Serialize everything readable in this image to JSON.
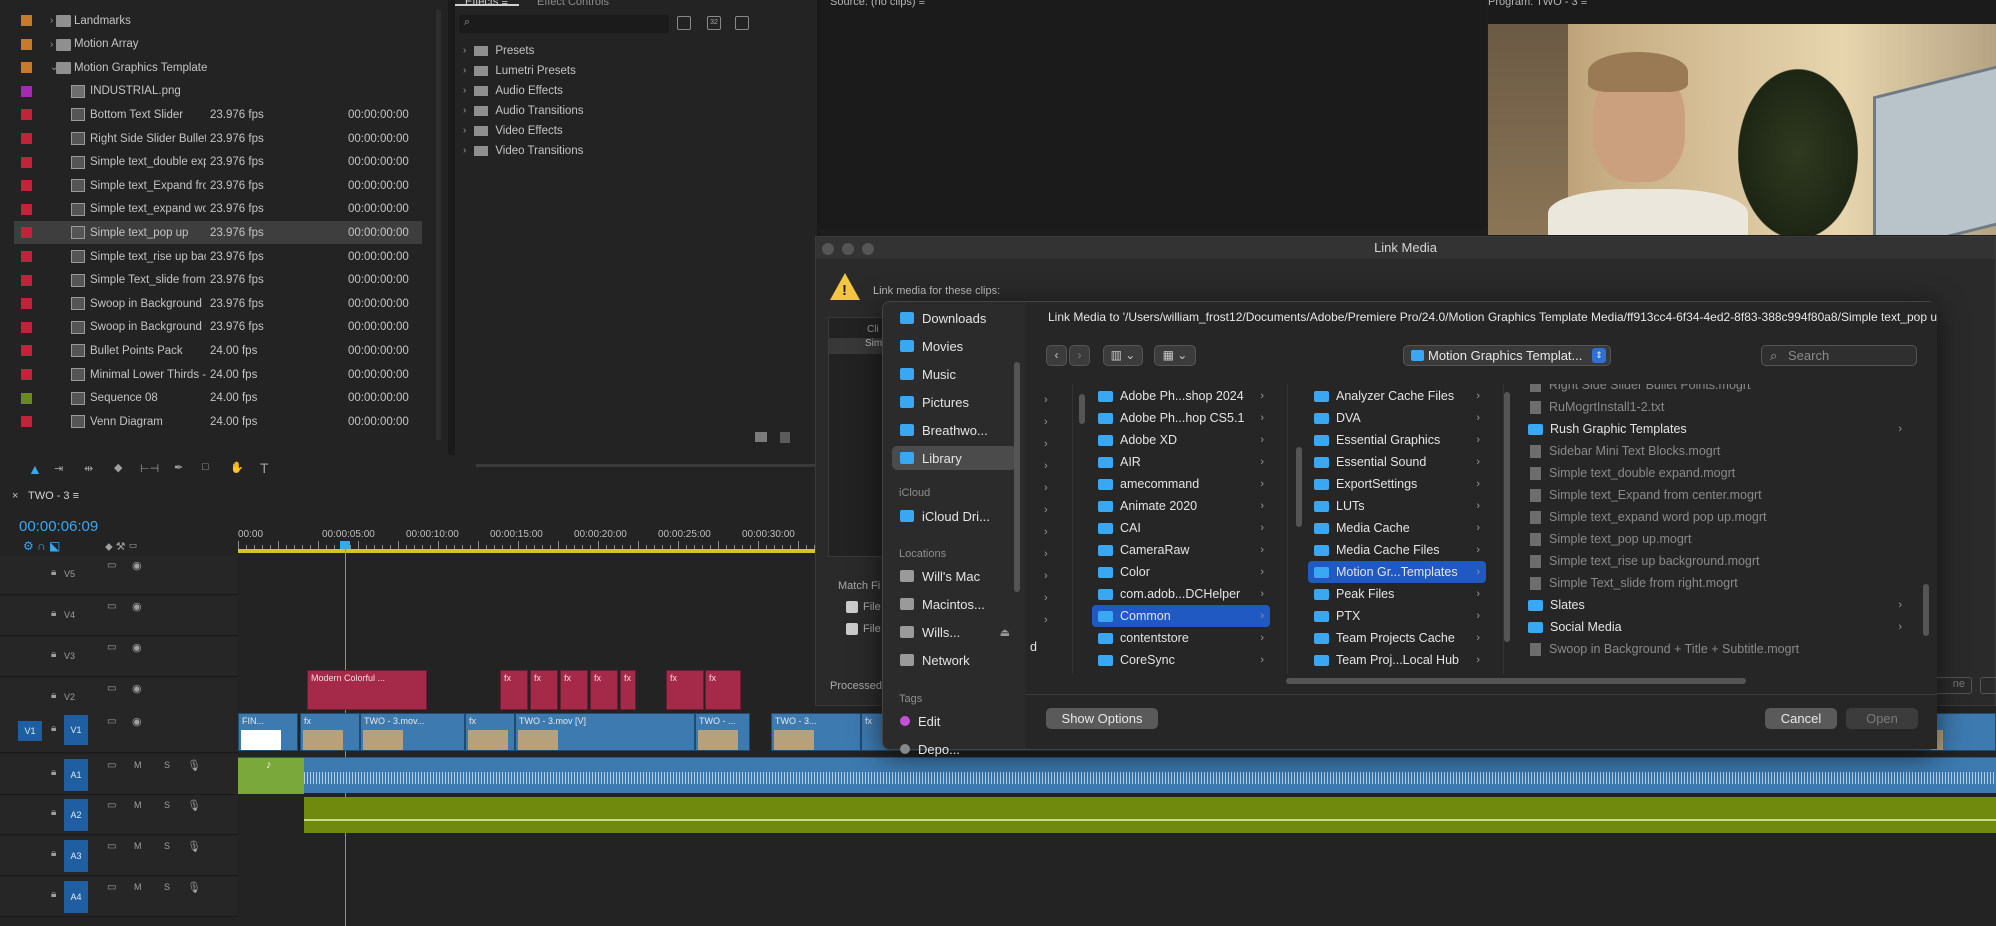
{
  "project": {
    "rows": [
      {
        "name": "Landmarks",
        "type": "folder",
        "color": "#c77a2a",
        "fps": "",
        "dur": ""
      },
      {
        "name": "Motion Array",
        "type": "folder",
        "color": "#c77a2a",
        "fps": "",
        "dur": ""
      },
      {
        "name": "Motion Graphics Template",
        "type": "folder-open",
        "color": "#c77a2a",
        "fps": "",
        "dur": ""
      },
      {
        "name": "INDUSTRIAL.png",
        "type": "image",
        "color": "#a42ab0",
        "fps": "",
        "dur": ""
      },
      {
        "name": "Bottom Text Slider",
        "type": "clip",
        "color": "#c2233a",
        "fps": "23.976 fps",
        "dur": "00:00:00:00"
      },
      {
        "name": "Right Side Slider Bullet",
        "type": "clip",
        "color": "#c2233a",
        "fps": "23.976 fps",
        "dur": "00:00:00:00"
      },
      {
        "name": "Simple text_double exp",
        "type": "clip",
        "color": "#c2233a",
        "fps": "23.976 fps",
        "dur": "00:00:00:00"
      },
      {
        "name": "Simple text_Expand fro",
        "type": "clip",
        "color": "#c2233a",
        "fps": "23.976 fps",
        "dur": "00:00:00:00"
      },
      {
        "name": "Simple text_expand wor",
        "type": "clip",
        "color": "#c2233a",
        "fps": "23.976 fps",
        "dur": "00:00:00:00"
      },
      {
        "name": "Simple text_pop up",
        "type": "clip",
        "color": "#c2233a",
        "fps": "23.976 fps",
        "dur": "00:00:00:00",
        "selected": true
      },
      {
        "name": "Simple text_rise up bac",
        "type": "clip",
        "color": "#c2233a",
        "fps": "23.976 fps",
        "dur": "00:00:00:00"
      },
      {
        "name": "Simple Text_slide from r",
        "type": "clip",
        "color": "#c2233a",
        "fps": "23.976 fps",
        "dur": "00:00:00:00"
      },
      {
        "name": "Swoop in Background",
        "type": "clip",
        "color": "#c2233a",
        "fps": "23.976 fps",
        "dur": "00:00:00:00"
      },
      {
        "name": "Swoop in Background +",
        "type": "clip",
        "color": "#c2233a",
        "fps": "23.976 fps",
        "dur": "00:00:00:00"
      },
      {
        "name": "Bullet Points Pack",
        "type": "clip",
        "color": "#c2233a",
        "fps": "24.00 fps",
        "dur": "00:00:00:00"
      },
      {
        "name": "Minimal Lower Thirds -",
        "type": "clip",
        "color": "#c2233a",
        "fps": "24.00 fps",
        "dur": "00:00:00:00"
      },
      {
        "name": "Sequence 08",
        "type": "sequence",
        "color": "#6b8a1e",
        "fps": "24.00 fps",
        "dur": "00:00:00:00"
      },
      {
        "name": "Venn Diagram",
        "type": "clip",
        "color": "#c2233a",
        "fps": "24.00 fps",
        "dur": "00:00:00:00"
      }
    ]
  },
  "effects": {
    "tab1": "Effects",
    "tab2": "Effect Controls",
    "items": [
      "Presets",
      "Lumetri Presets",
      "Audio Effects",
      "Audio Transitions",
      "Video Effects",
      "Video Transitions"
    ]
  },
  "source": {
    "label": "Source: (no clips)"
  },
  "program": {
    "label": "Program: TWO - 3"
  },
  "timeline": {
    "tab": "TWO - 3",
    "timecode": "00:00:06:09",
    "ruler": [
      "00:00",
      "00:00:05:00",
      "00:00:10:00",
      "00:00:15:00",
      "00:00:20:00",
      "00:00:25:00",
      "00:00:30:00",
      "00:"
    ],
    "video_tracks": [
      "V5",
      "V4",
      "V3",
      "V2",
      "V1"
    ],
    "audio_tracks": [
      "A1",
      "A2",
      "A3",
      "A4"
    ],
    "source_patch_v": "V1",
    "track_buttons": {
      "mute": "M",
      "solo": "S"
    },
    "graphic_clip": "Modern Colorful ...",
    "v1_clips": [
      "FIN...",
      "TWO - 3.mov...",
      "TWO - 3.mov [V]",
      "TWO - ...",
      "TWO - 3...",
      "[V]"
    ]
  },
  "link_media": {
    "title": "Link Media",
    "warning": "Link media for these clips:",
    "clips_label": "Cli",
    "clip_row": "Sim",
    "match_label": "Match Fi",
    "check1": "File",
    "check2": "File",
    "processed": "Processed",
    "right_btn": "ne"
  },
  "chooser": {
    "path": "Link Media to '/Users/william_frost12/Documents/Adobe/Premiere Pro/24.0/Motion Graphics Template Media/ff913cc4-6f34-4ed2-8f83-388c994f80a8/Simple text_pop u...",
    "location": "Motion Graphics Templat...",
    "search_placeholder": "Search",
    "sidebar": {
      "favorites": [
        {
          "label": "Downloads",
          "icon": "downloads-icon"
        },
        {
          "label": "Movies",
          "icon": "movies-icon"
        },
        {
          "label": "Music",
          "icon": "music-icon"
        },
        {
          "label": "Pictures",
          "icon": "pictures-icon"
        },
        {
          "label": "Breathwo...",
          "icon": "folder-icon"
        },
        {
          "label": "Library",
          "icon": "library-icon",
          "selected": true
        }
      ],
      "icloud_head": "iCloud",
      "icloud": [
        {
          "label": "iCloud Dri...",
          "icon": "cloud-icon"
        }
      ],
      "locations_head": "Locations",
      "locations": [
        {
          "label": "Will's Mac",
          "icon": "laptop-icon"
        },
        {
          "label": "Macintos...",
          "icon": "disk-icon"
        },
        {
          "label": "Wills...",
          "icon": "disk-icon",
          "eject": "⏏"
        },
        {
          "label": "Network",
          "icon": "network-icon"
        }
      ],
      "tags_head": "Tags",
      "tags": [
        {
          "label": "Edit",
          "color": "#c44fd9"
        },
        {
          "label": "Depo...",
          "color": "#888888"
        }
      ]
    },
    "col0_tail": "d",
    "col1": [
      "Adobe Ph...shop 2024",
      "Adobe Ph...hop CS5.1",
      "Adobe XD",
      "AIR",
      "amecommand",
      "Animate 2020",
      "CAI",
      "CameraRaw",
      "Color",
      "com.adob...DCHelper",
      "Common",
      "contentstore",
      "CoreSync"
    ],
    "col1_selected": "Common",
    "col2": [
      "Analyzer Cache Files",
      "DVA",
      "Essential Graphics",
      "Essential Sound",
      "ExportSettings",
      "LUTs",
      "Media Cache",
      "Media Cache Files",
      "Motion Gr...Templates",
      "Peak Files",
      "PTX",
      "Team Projects Cache",
      "Team Proj...Local Hub"
    ],
    "col2_selected": "Motion Gr...Templates",
    "col3": [
      {
        "name": "Right Side Slider Bullet Points.mogrt",
        "kind": "file"
      },
      {
        "name": "RuMogrtInstall1-2.txt",
        "kind": "file"
      },
      {
        "name": "Rush Graphic Templates",
        "kind": "folder"
      },
      {
        "name": "Sidebar Mini Text Blocks.mogrt",
        "kind": "file"
      },
      {
        "name": "Simple text_double expand.mogrt",
        "kind": "file"
      },
      {
        "name": "Simple text_Expand from center.mogrt",
        "kind": "file"
      },
      {
        "name": "Simple text_expand word pop up.mogrt",
        "kind": "file"
      },
      {
        "name": "Simple text_pop up.mogrt",
        "kind": "file"
      },
      {
        "name": "Simple text_rise up background.mogrt",
        "kind": "file"
      },
      {
        "name": "Simple Text_slide from right.mogrt",
        "kind": "file"
      },
      {
        "name": "Slates",
        "kind": "folder"
      },
      {
        "name": "Social Media",
        "kind": "folder"
      },
      {
        "name": "Swoop in Background + Title + Subtitle.mogrt",
        "kind": "file"
      }
    ],
    "show_options": "Show Options",
    "cancel": "Cancel",
    "open": "Open",
    "accent": "#2159c2"
  }
}
